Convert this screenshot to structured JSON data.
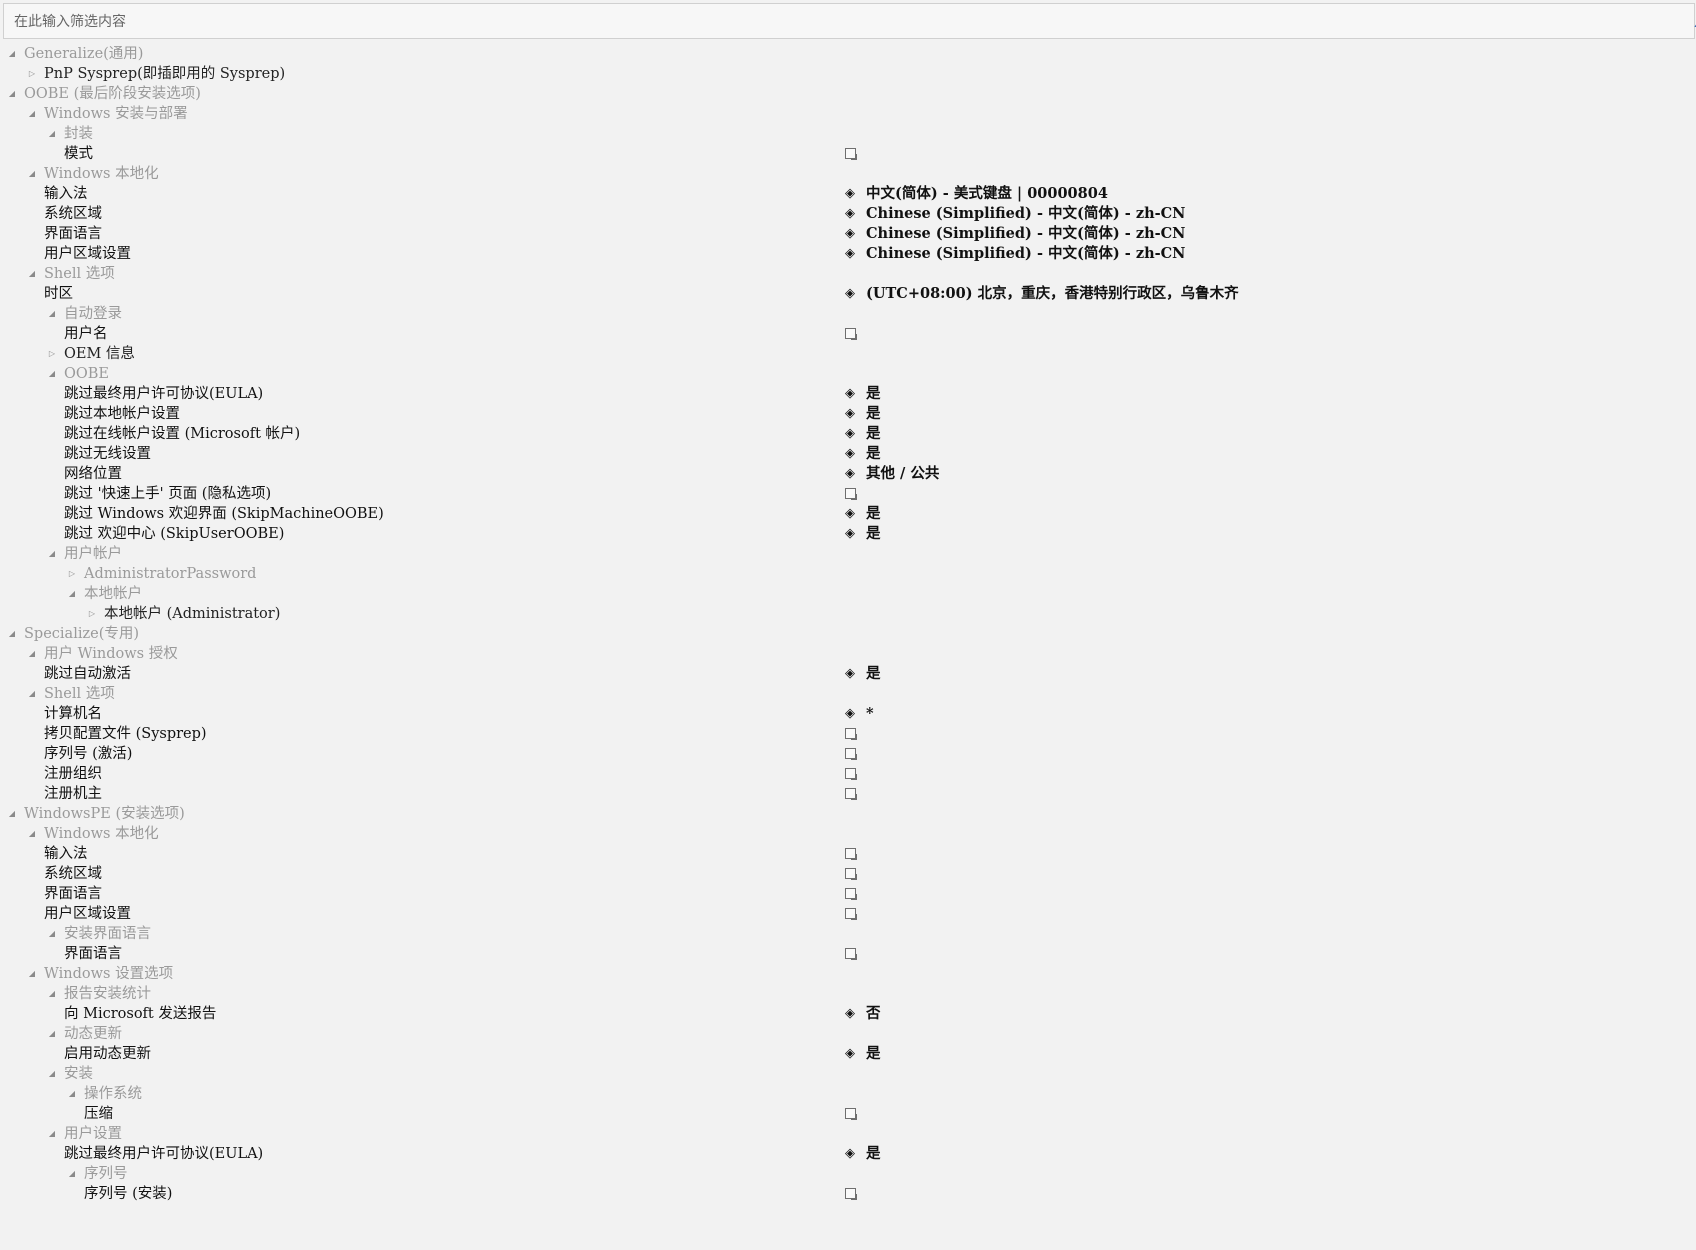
{
  "filter": {
    "placeholder": "在此输入筛选内容"
  },
  "rows": [
    {
      "depth": 0,
      "toggle": "▲",
      "label": "Generalize(通用)",
      "kind": "grp"
    },
    {
      "depth": 1,
      "toggle": "▷",
      "label": "PnP Sysprep(即插即用的 Sysprep)",
      "kind": "bold-grp"
    },
    {
      "depth": 0,
      "toggle": "▲",
      "label": "OOBE (最后阶段安装选项)",
      "kind": "grp"
    },
    {
      "depth": 1,
      "toggle": "▲",
      "label": "Windows 安装与部署",
      "kind": "grp"
    },
    {
      "depth": 2,
      "toggle": "▲",
      "label": "封装",
      "kind": "grp"
    },
    {
      "depth": 2,
      "toggle": "",
      "label": "模式",
      "kind": "leaf",
      "icon": "empty"
    },
    {
      "depth": 1,
      "toggle": "▲",
      "label": "Windows 本地化",
      "kind": "grp"
    },
    {
      "depth": 1,
      "toggle": "",
      "label": "输入法",
      "kind": "leaf",
      "icon": "diamond",
      "value": "中文(简体) - 美式键盘 | 00000804"
    },
    {
      "depth": 1,
      "toggle": "",
      "label": "系统区域",
      "kind": "leaf",
      "icon": "diamond",
      "value": "Chinese (Simplified) - 中文(简体) - zh-CN"
    },
    {
      "depth": 1,
      "toggle": "",
      "label": "界面语言",
      "kind": "leaf",
      "icon": "diamond",
      "value": "Chinese (Simplified) - 中文(简体) - zh-CN"
    },
    {
      "depth": 1,
      "toggle": "",
      "label": "用户区域设置",
      "kind": "leaf",
      "icon": "diamond",
      "value": "Chinese (Simplified) - 中文(简体) - zh-CN"
    },
    {
      "depth": 1,
      "toggle": "▲",
      "label": "Shell 选项",
      "kind": "grp"
    },
    {
      "depth": 1,
      "toggle": "",
      "label": "时区",
      "kind": "leaf",
      "icon": "diamond",
      "value": "(UTC+08:00) 北京，重庆，香港特别行政区，乌鲁木齐"
    },
    {
      "depth": 2,
      "toggle": "▲",
      "label": "自动登录",
      "kind": "grp"
    },
    {
      "depth": 2,
      "toggle": "",
      "label": "用户名",
      "kind": "leaf",
      "icon": "empty"
    },
    {
      "depth": 2,
      "toggle": "▷",
      "label": "OEM 信息",
      "kind": "bold-grp"
    },
    {
      "depth": 2,
      "toggle": "▲",
      "label": "OOBE",
      "kind": "grp"
    },
    {
      "depth": 2,
      "toggle": "",
      "label": "跳过最终用户许可协议(EULA)",
      "kind": "leaf",
      "icon": "diamond",
      "value": "是"
    },
    {
      "depth": 2,
      "toggle": "",
      "label": "跳过本地帐户设置",
      "kind": "leaf",
      "icon": "diamond",
      "value": "是"
    },
    {
      "depth": 2,
      "toggle": "",
      "label": "跳过在线帐户设置 (Microsoft 帐户)",
      "kind": "leaf",
      "icon": "diamond",
      "value": "是"
    },
    {
      "depth": 2,
      "toggle": "",
      "label": "跳过无线设置",
      "kind": "leaf",
      "icon": "diamond",
      "value": "是"
    },
    {
      "depth": 2,
      "toggle": "",
      "label": "网络位置",
      "kind": "leaf",
      "icon": "diamond",
      "value": "其他 / 公共"
    },
    {
      "depth": 2,
      "toggle": "",
      "label": "跳过 '快速上手' 页面 (隐私选项)",
      "kind": "leaf",
      "icon": "empty"
    },
    {
      "depth": 2,
      "toggle": "",
      "label": "跳过 Windows 欢迎界面 (SkipMachineOOBE)",
      "kind": "leaf",
      "icon": "diamond",
      "value": "是"
    },
    {
      "depth": 2,
      "toggle": "",
      "label": "跳过 欢迎中心 (SkipUserOOBE)",
      "kind": "leaf",
      "icon": "diamond",
      "value": "是"
    },
    {
      "depth": 2,
      "toggle": "▲",
      "label": "用户帐户",
      "kind": "grp"
    },
    {
      "depth": 3,
      "toggle": "▷",
      "label": "AdministratorPassword",
      "kind": "grp"
    },
    {
      "depth": 3,
      "toggle": "▲",
      "label": "本地帐户",
      "kind": "grp"
    },
    {
      "depth": 4,
      "toggle": "▷",
      "label": "本地帐户 (Administrator)",
      "kind": "bold-grp"
    },
    {
      "depth": 0,
      "toggle": "▲",
      "label": "Specialize(专用)",
      "kind": "grp"
    },
    {
      "depth": 1,
      "toggle": "▲",
      "label": "用户 Windows 授权",
      "kind": "grp"
    },
    {
      "depth": 1,
      "toggle": "",
      "label": "跳过自动激活",
      "kind": "leaf",
      "icon": "diamond",
      "value": "是"
    },
    {
      "depth": 1,
      "toggle": "▲",
      "label": "Shell 选项",
      "kind": "grp"
    },
    {
      "depth": 1,
      "toggle": "",
      "label": "计算机名",
      "kind": "leaf",
      "icon": "diamond",
      "value": "*"
    },
    {
      "depth": 1,
      "toggle": "",
      "label": "拷贝配置文件 (Sysprep)",
      "kind": "leaf",
      "icon": "empty"
    },
    {
      "depth": 1,
      "toggle": "",
      "label": "序列号 (激活)",
      "kind": "leaf",
      "icon": "empty"
    },
    {
      "depth": 1,
      "toggle": "",
      "label": "注册组织",
      "kind": "leaf",
      "icon": "empty"
    },
    {
      "depth": 1,
      "toggle": "",
      "label": "注册机主",
      "kind": "leaf",
      "icon": "empty"
    },
    {
      "depth": 0,
      "toggle": "▲",
      "label": "WindowsPE (安装选项)",
      "kind": "grp"
    },
    {
      "depth": 1,
      "toggle": "▲",
      "label": "Windows 本地化",
      "kind": "grp"
    },
    {
      "depth": 1,
      "toggle": "",
      "label": "输入法",
      "kind": "leaf",
      "icon": "empty"
    },
    {
      "depth": 1,
      "toggle": "",
      "label": "系统区域",
      "kind": "leaf",
      "icon": "empty"
    },
    {
      "depth": 1,
      "toggle": "",
      "label": "界面语言",
      "kind": "leaf",
      "icon": "empty"
    },
    {
      "depth": 1,
      "toggle": "",
      "label": "用户区域设置",
      "kind": "leaf",
      "icon": "empty"
    },
    {
      "depth": 2,
      "toggle": "▲",
      "label": "安装界面语言",
      "kind": "grp"
    },
    {
      "depth": 2,
      "toggle": "",
      "label": "界面语言",
      "kind": "leaf",
      "icon": "empty"
    },
    {
      "depth": 1,
      "toggle": "▲",
      "label": "Windows 设置选项",
      "kind": "grp"
    },
    {
      "depth": 2,
      "toggle": "▲",
      "label": "报告安装统计",
      "kind": "grp"
    },
    {
      "depth": 2,
      "toggle": "",
      "label": "向 Microsoft 发送报告",
      "kind": "leaf",
      "icon": "diamond",
      "value": "否"
    },
    {
      "depth": 2,
      "toggle": "▲",
      "label": "动态更新",
      "kind": "grp"
    },
    {
      "depth": 2,
      "toggle": "",
      "label": "启用动态更新",
      "kind": "leaf",
      "icon": "diamond",
      "value": "是"
    },
    {
      "depth": 2,
      "toggle": "▲",
      "label": "安装",
      "kind": "grp"
    },
    {
      "depth": 3,
      "toggle": "▲",
      "label": "操作系统",
      "kind": "grp"
    },
    {
      "depth": 3,
      "toggle": "",
      "label": "压缩",
      "kind": "leaf",
      "icon": "empty"
    },
    {
      "depth": 2,
      "toggle": "▲",
      "label": "用户设置",
      "kind": "grp"
    },
    {
      "depth": 2,
      "toggle": "",
      "label": "跳过最终用户许可协议(EULA)",
      "kind": "leaf",
      "icon": "diamond",
      "value": "是"
    },
    {
      "depth": 3,
      "toggle": "▲",
      "label": "序列号",
      "kind": "grp"
    },
    {
      "depth": 3,
      "toggle": "",
      "label": "序列号 (安装)",
      "kind": "leaf",
      "icon": "empty"
    }
  ]
}
